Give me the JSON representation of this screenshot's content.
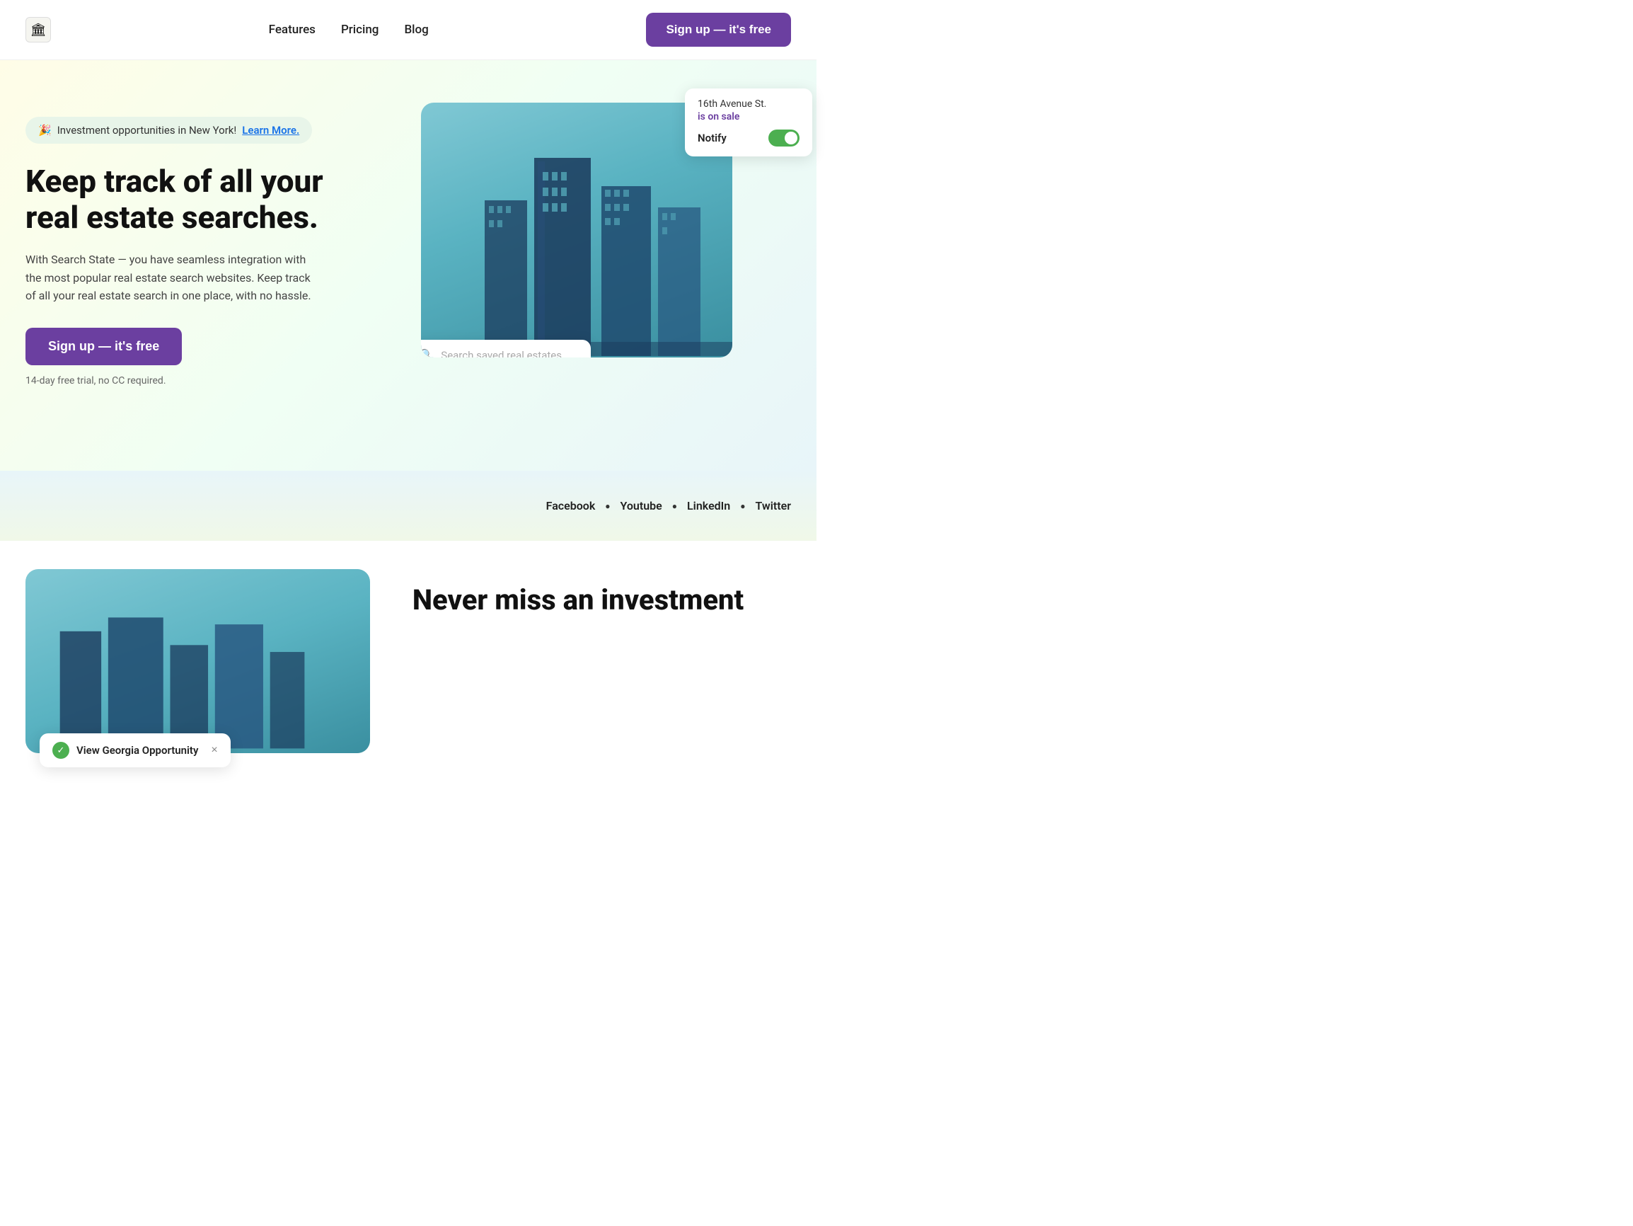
{
  "header": {
    "logo_icon": "🏛",
    "nav_items": [
      {
        "label": "Features",
        "id": "features"
      },
      {
        "label": "Pricing",
        "id": "pricing"
      },
      {
        "label": "Blog",
        "id": "blog"
      }
    ],
    "signup_label": "Sign up — it's free"
  },
  "hero": {
    "announcement": {
      "emoji": "🎉",
      "text": "Investment opportunities in New York!",
      "link_label": "Learn More."
    },
    "title": "Keep track of all your real estate searches.",
    "description": "With Search State — you have seamless integration with the most popular real estate search websites. Keep track of all your real estate search in one place, with no hassle.",
    "signup_label": "Sign up — it's free",
    "trial_note": "14-day free trial, no CC required.",
    "notify_card": {
      "address": "16th Avenue St.",
      "sale_status": "is on sale",
      "notify_label": "Notify"
    },
    "search_placeholder": "Search saved real estates"
  },
  "social": {
    "links": [
      {
        "label": "Facebook",
        "id": "facebook"
      },
      {
        "label": "Youtube",
        "id": "youtube"
      },
      {
        "label": "LinkedIn",
        "id": "linkedin"
      },
      {
        "label": "Twitter",
        "id": "twitter"
      }
    ]
  },
  "second_section": {
    "toast": {
      "text": "View Georgia Opportunity",
      "close": "×"
    },
    "title_line1": "Never miss an investment"
  }
}
